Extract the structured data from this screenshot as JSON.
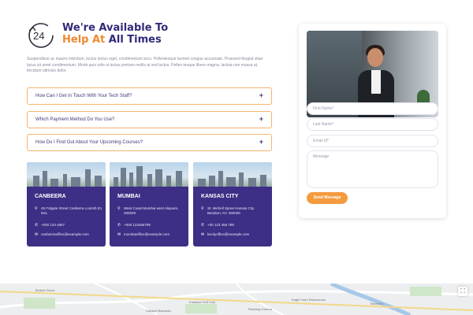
{
  "header": {
    "title_line1": "We're Available To",
    "title_accent": "Help At",
    "title_rest": "All Times",
    "icon_text": "24",
    "intro": "Suspendisse ac mauris interdum, luctus lectus eget, condimentum arcu. Pellentesque laoreet congue accumsan. Praesent feugiat vitae lacus sit amet condimentum. Morbi quis odio ut lectus pretium mollis at sed lectus. Pellen tesque libero magna, lacinia non massa at, tincidunt ultricies dolor."
  },
  "faqs": [
    {
      "question": "How Can I Get In Touch With Your Tech Staff?",
      "icon": "+"
    },
    {
      "question": "Which Payment Method Do You Use?",
      "icon": "+"
    },
    {
      "question": "How Do I Find Out About Your Upcoming Courses?",
      "icon": "+"
    }
  ],
  "offices": [
    {
      "city": "CANBEERA",
      "address": "45 Folgate Street Canberra Looloth E1 6GL",
      "phone": "+000 123 4567",
      "email": "canbeeraoffice@example.com"
    },
    {
      "city": "MUMBAI",
      "address": "West Coast Mumbai west Aliquam, 400029",
      "phone": "+000 123456789",
      "email": "mumbaioffice@example.com"
    },
    {
      "city": "KANSAS CITY",
      "address": "St. Michell Spree Kansas City Bendum, KC 450028",
      "phone": "+00 123 456 789",
      "email": "kscityoffice@example.com"
    }
  ],
  "form": {
    "first_name_placeholder": "First Name*",
    "last_name_placeholder": "Last Name*",
    "email_placeholder": "Email Id*",
    "message_placeholder": "Message",
    "send_label": "Send Message"
  },
  "map": {
    "labels": [
      "Bellard Grove",
      "Gallojoh Barracks",
      "Fastland Golf Club",
      "Reading Cinema",
      "Eagle Farm Racecourse",
      "Brisbane"
    ],
    "fullscreen_icon": "⛶"
  },
  "colors": {
    "primary": "#3c2f85",
    "accent": "#f0892e",
    "button": "#f49b3f"
  }
}
